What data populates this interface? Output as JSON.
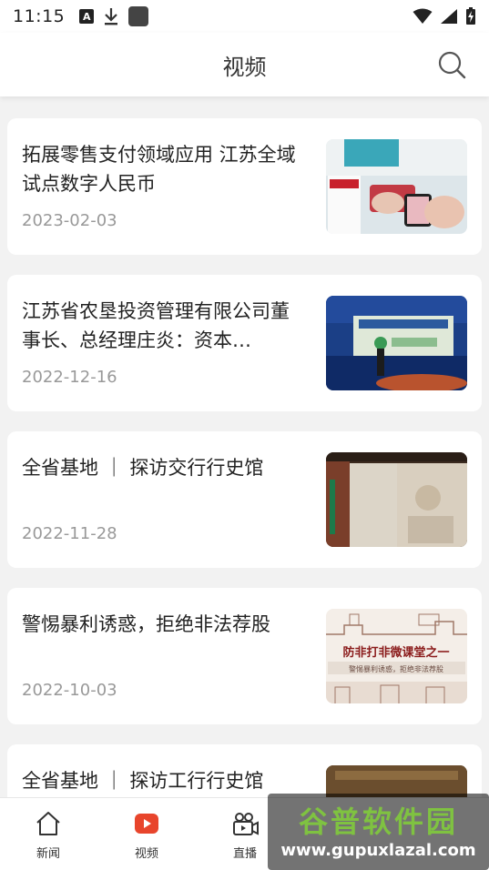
{
  "status_bar": {
    "time": "11:15",
    "notif_letter": "A"
  },
  "header": {
    "title": "视频"
  },
  "articles": [
    {
      "title": "拓展零售支付领域应用  江苏全域试点数字人民币",
      "date": "2023-02-03",
      "thumb_text": ""
    },
    {
      "title": "江苏省农垦投资管理有限公司董事长、总经理庄炎：资本…",
      "date": "2022-12-16",
      "thumb_text": ""
    },
    {
      "title": "全省基地 ｜ 探访交行行史馆",
      "date": "2022-11-28",
      "thumb_text": ""
    },
    {
      "title": "警惕暴利诱惑，拒绝非法荐股",
      "date": "2022-10-03",
      "thumb_text": "防非打非微课堂之一",
      "thumb_subtext": "警惕暴利诱惑，拒绝非法荐股"
    },
    {
      "title": "全省基地 ｜ 探访工行行史馆",
      "date": "",
      "thumb_text": ""
    }
  ],
  "tabbar": {
    "tabs": [
      {
        "label": "新闻",
        "icon": "home-icon",
        "active": false
      },
      {
        "label": "视频",
        "icon": "play-icon",
        "active": true
      },
      {
        "label": "直播",
        "icon": "camera-icon",
        "active": false
      }
    ]
  },
  "watermark": {
    "line1": "谷普软件园",
    "line2": "www.gupuxlazal.com"
  },
  "colors": {
    "accent": "#e8452c",
    "text": "#222222",
    "date": "#999999"
  }
}
